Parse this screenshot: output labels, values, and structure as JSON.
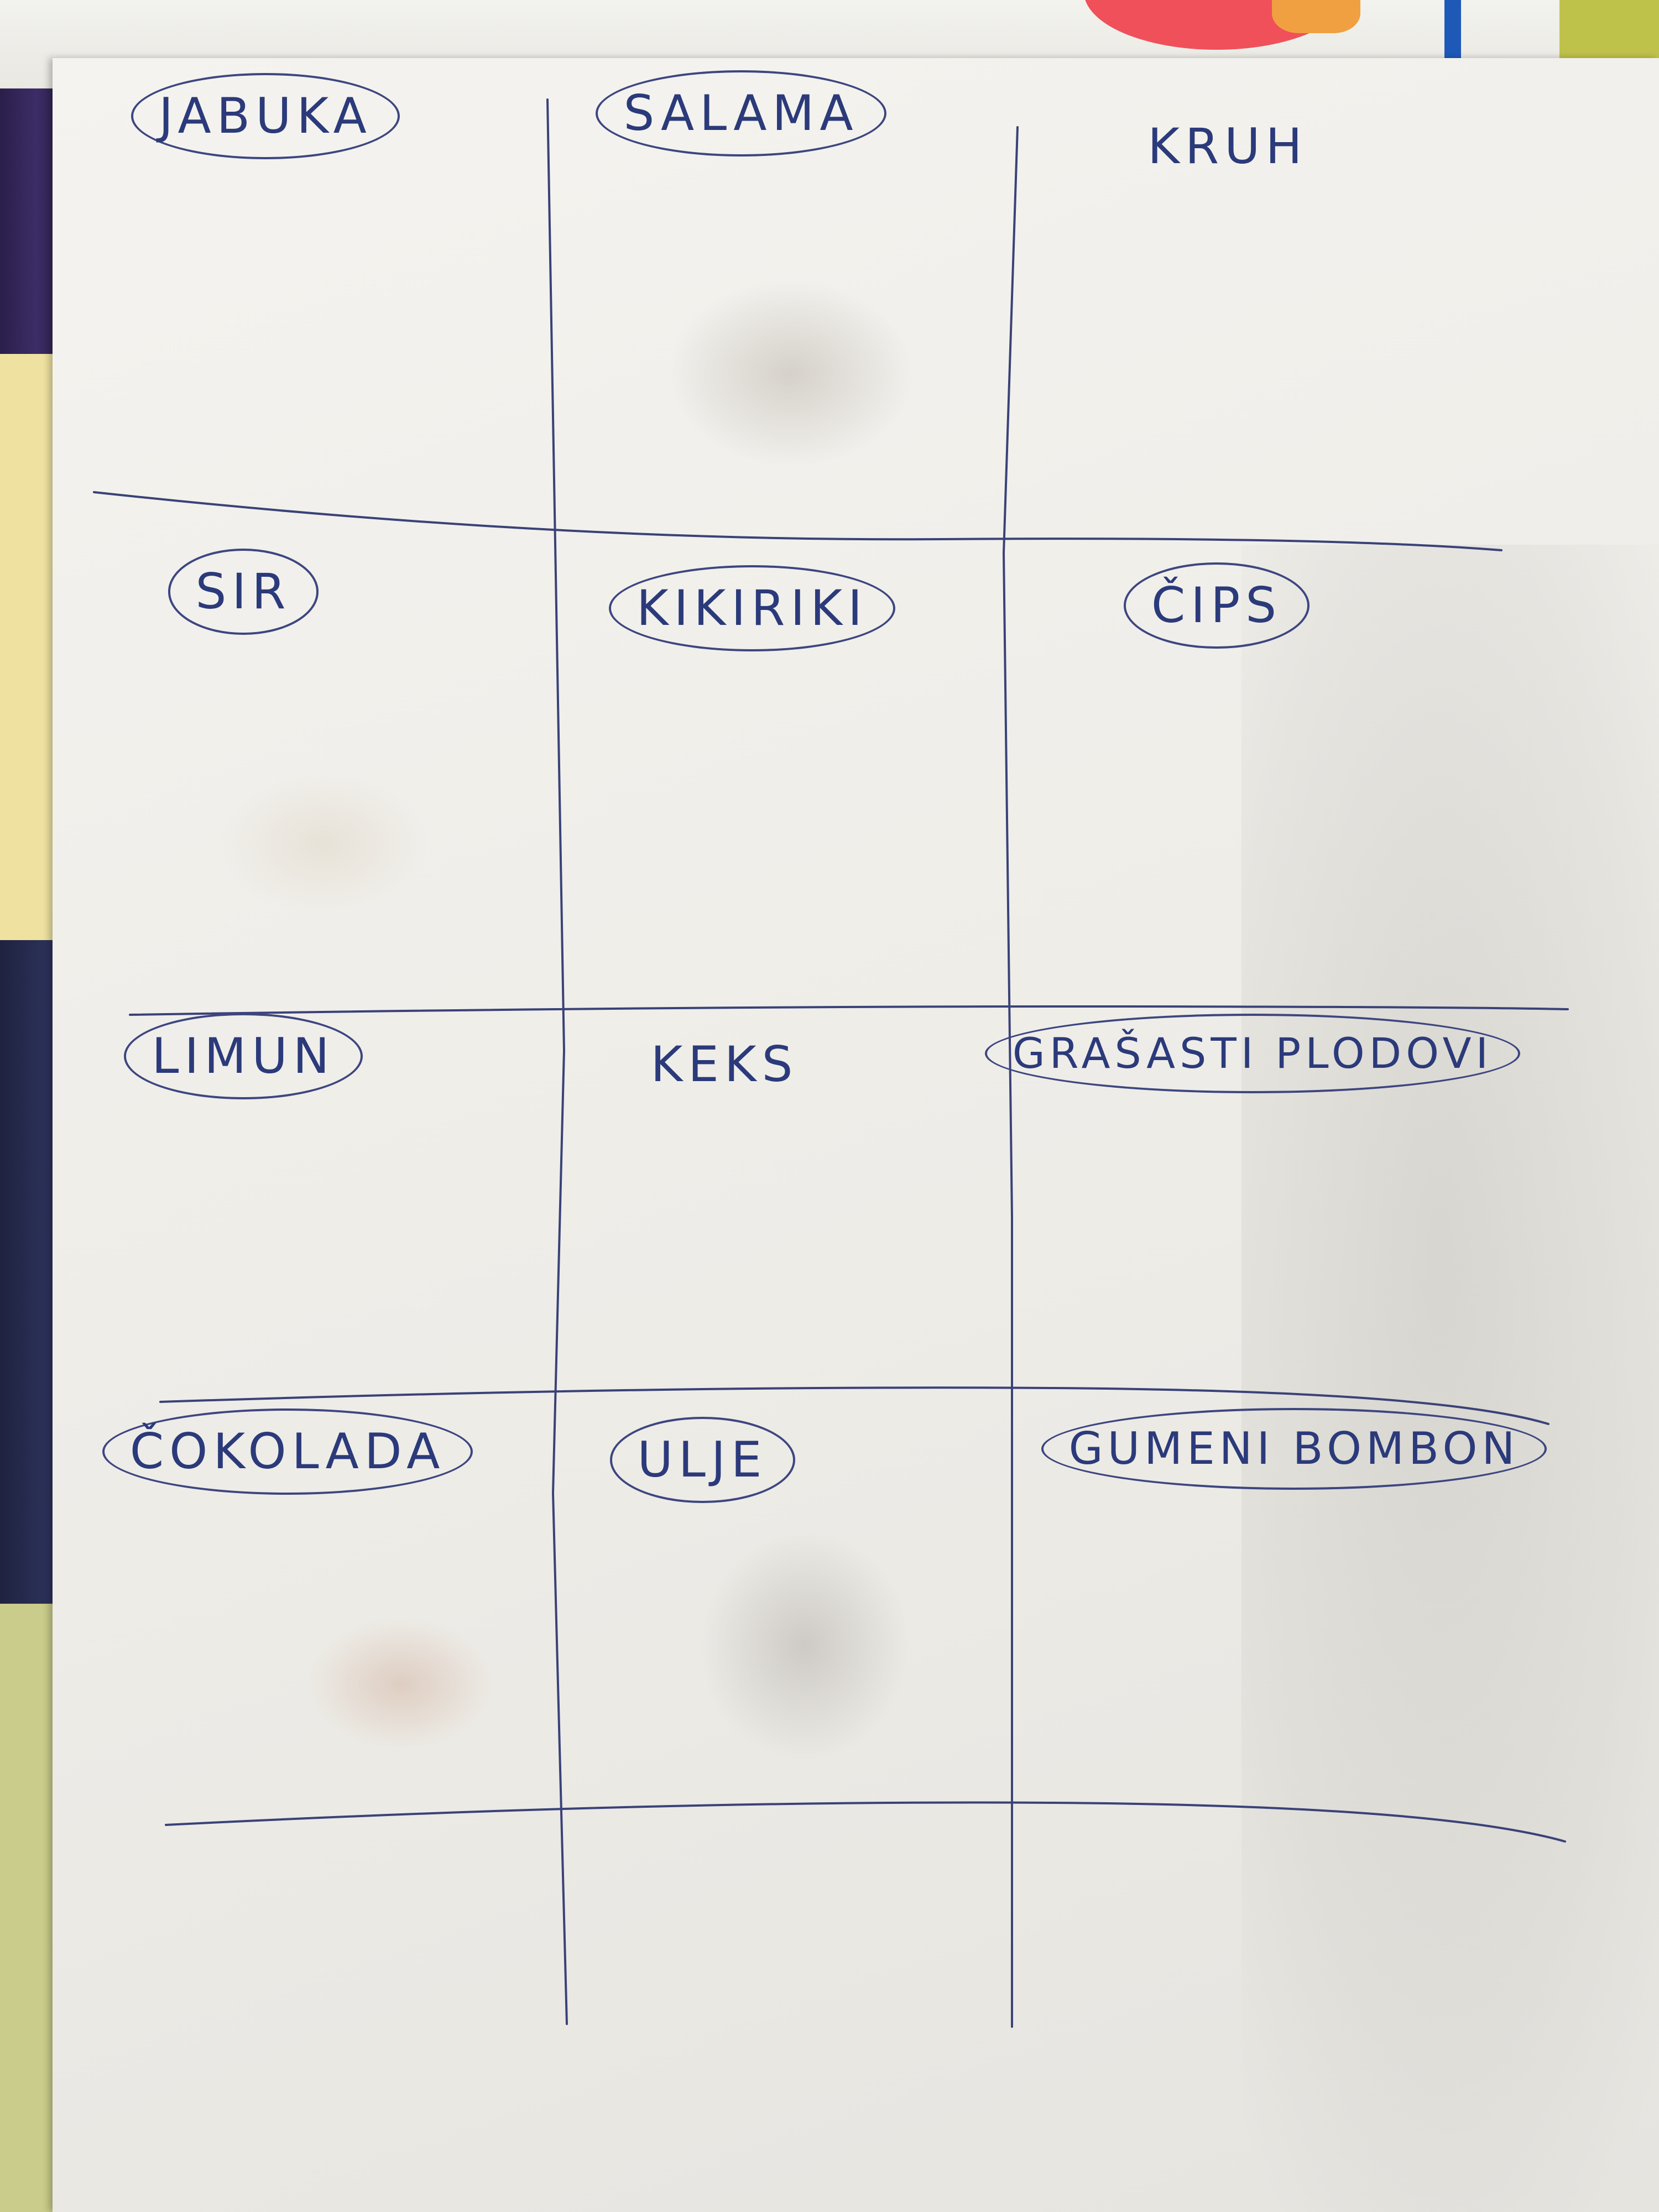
{
  "sheet": {
    "cells": [
      {
        "label": "JABUKA",
        "circled": true
      },
      {
        "label": "SALAMA",
        "circled": true
      },
      {
        "label": "KRUH",
        "circled": false
      },
      {
        "label": "SIR",
        "circled": true
      },
      {
        "label": "KIKIRIKI",
        "circled": true
      },
      {
        "label": "ČIPS",
        "circled": true
      },
      {
        "label": "LIMUN",
        "circled": true
      },
      {
        "label": "KEKS",
        "circled": false
      },
      {
        "label": "GRAŠASTI PLODOVI",
        "circled": true
      },
      {
        "label": "ČOKOLADA",
        "circled": true
      },
      {
        "label": "ULJE",
        "circled": true
      },
      {
        "label": "GUMENI BOMBON",
        "circled": true
      }
    ]
  },
  "colors": {
    "ink": "#2b3a7a",
    "paper": "#f1f0ec"
  }
}
